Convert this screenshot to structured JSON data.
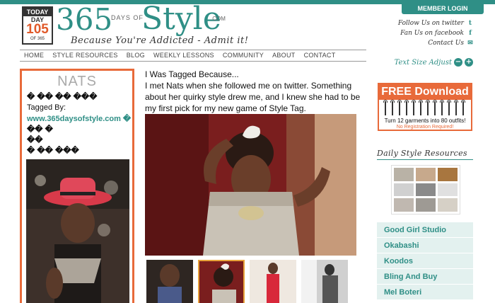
{
  "header": {
    "member_login": "MEMBER LOGIN",
    "logo": {
      "today": "TODAY",
      "day": "DAY",
      "day_number": "105",
      "of": "OF 365",
      "numeral": "365",
      "days_of": "DAYS OF",
      "style": "Style",
      "dotcom": ".COM"
    },
    "tagline": "Because You're Addicted - Admit it!",
    "social": [
      {
        "label": "Follow Us on twitter",
        "icon": "twitter-icon",
        "glyph": "t"
      },
      {
        "label": "Fan Us on facebook",
        "icon": "facebook-icon",
        "glyph": "f"
      },
      {
        "label": "Contact Us",
        "icon": "mail-icon",
        "glyph": "✉"
      }
    ],
    "text_size": {
      "label": "Text Size Adjust",
      "minus": "−",
      "plus": "+"
    }
  },
  "nav": {
    "items": [
      "HOME",
      "STYLE RESOURCES",
      "BLOG",
      "WEEKLY LESSONS",
      "COMMUNITY",
      "ABOUT",
      "CONTACT"
    ]
  },
  "left_card": {
    "name": "NATS",
    "garbled_1": "� �� �� ���",
    "tagged_by": "Tagged By:",
    "tagged_link": "www.365daysofstyle.com �",
    "garbled_2": "�� �",
    "garbled_3": "��",
    "garbled_4": "� �� ���"
  },
  "post": {
    "title": "I Was Tagged Because...",
    "body": "I met Nats when she followed me on twitter. Something about her quirky style drew me, and I knew she had to be my first pick for my new game of Style Tag."
  },
  "free_download": {
    "title": "FREE Download",
    "subtitle": "Turn 12 garments into 80 outfits!",
    "note": "No Registration Required!"
  },
  "daily_style": {
    "title": "Daily Style Resources"
  },
  "resources": {
    "items": [
      "Good Girl Studio",
      "Okabashi",
      "Koodos",
      "Bling And Buy",
      "Mel Boteri"
    ]
  }
}
